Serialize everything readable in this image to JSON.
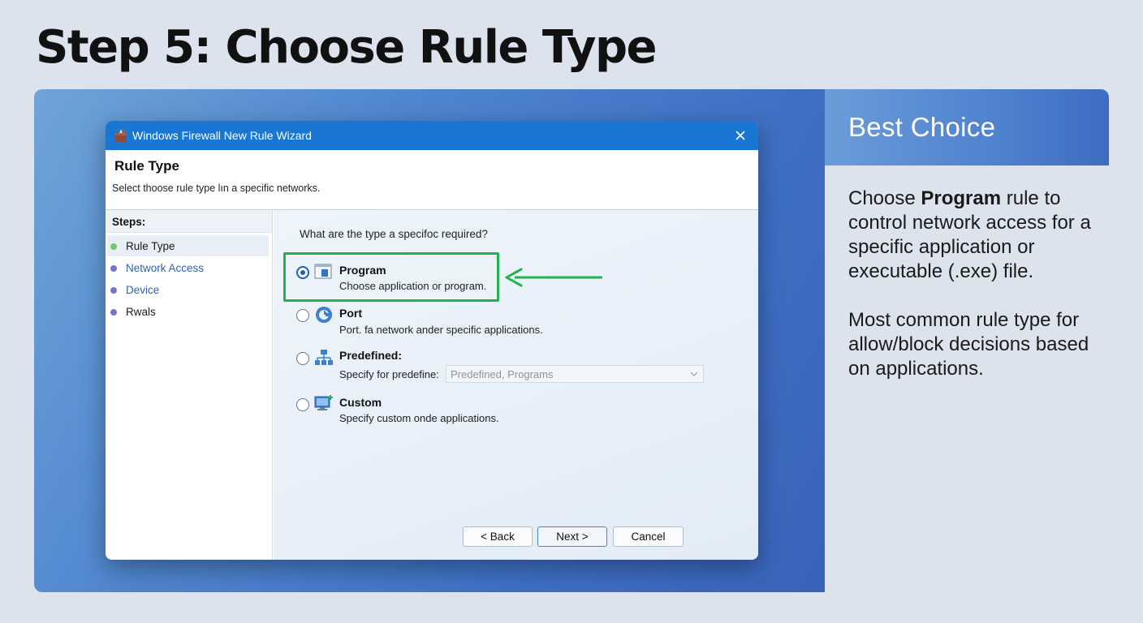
{
  "page": {
    "title": "Step 5: Choose Rule Type"
  },
  "side": {
    "title": "Best Choice",
    "p1_pre": "Choose ",
    "p1_bold": "Program",
    "p1_post": " rule to control network access for a specific application or executable (.exe) file.",
    "p2": "Most common rule type for allow/block decisions based on applications."
  },
  "dialog": {
    "title": "Windows Firewall New Rule Wizard",
    "close_icon": "close-icon",
    "header_title": "Rule Type",
    "header_subtitle": "Select thoose rule type lın a specific networks.",
    "steps_title": "Steps:",
    "steps": [
      {
        "label": "Rule Type",
        "dot_color": "#7cc46a",
        "text_color": "#1a1a1a"
      },
      {
        "label": "Network Access",
        "dot_color": "#7b6fd0",
        "text_color": "#2d63b3"
      },
      {
        "label": "Device",
        "dot_color": "#7b6fd0",
        "text_color": "#2d63b3"
      },
      {
        "label": "Rwals",
        "dot_color": "#7b6fd0",
        "text_color": "#1a1a1a"
      }
    ],
    "question": "What are the type a specifoc required?",
    "options": [
      {
        "title": "Program",
        "desc": "Choose application or program.",
        "selected": true,
        "icon": "program-window-icon"
      },
      {
        "title": "Port",
        "desc": "Port. fa network ander specific applications.",
        "selected": false,
        "icon": "port-icon"
      },
      {
        "title": "Predefined:",
        "desc": "Specify for predefine:",
        "selected": false,
        "icon": "network-tree-icon"
      },
      {
        "title": "Custom",
        "desc": "Specify custom onde applications.",
        "selected": false,
        "icon": "custom-monitor-icon"
      }
    ],
    "predefined_select": "Predefined, Programs",
    "buttons": {
      "back": "< Back",
      "next": "Next >",
      "cancel": "Cancel"
    }
  },
  "colors": {
    "highlight": "#23b24b",
    "titlebar": "#1976d2"
  }
}
